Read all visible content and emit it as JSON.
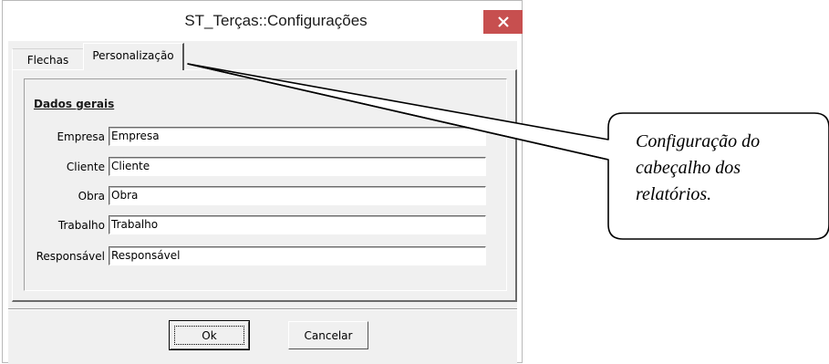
{
  "window": {
    "title": "ST_Terças::Configurações",
    "close_icon": "close-icon"
  },
  "tabs": [
    {
      "label": "Flechas",
      "active": false
    },
    {
      "label": "Personalização",
      "active": true
    }
  ],
  "group": {
    "title": "Dados gerais"
  },
  "fields": [
    {
      "label": "Empresa",
      "value": "Empresa"
    },
    {
      "label": "Cliente",
      "value": "Cliente"
    },
    {
      "label": "Obra",
      "value": "Obra"
    },
    {
      "label": "Trabalho",
      "value": "Trabalho"
    },
    {
      "label": "Responsável",
      "value": "Responsável"
    }
  ],
  "buttons": {
    "ok": "Ok",
    "cancel": "Cancelar"
  },
  "callout": {
    "text": "Configuração do cabeçalho dos relatórios."
  },
  "colors": {
    "close_button": "#c74f4f",
    "dialog_background": "#f0f0f0"
  }
}
